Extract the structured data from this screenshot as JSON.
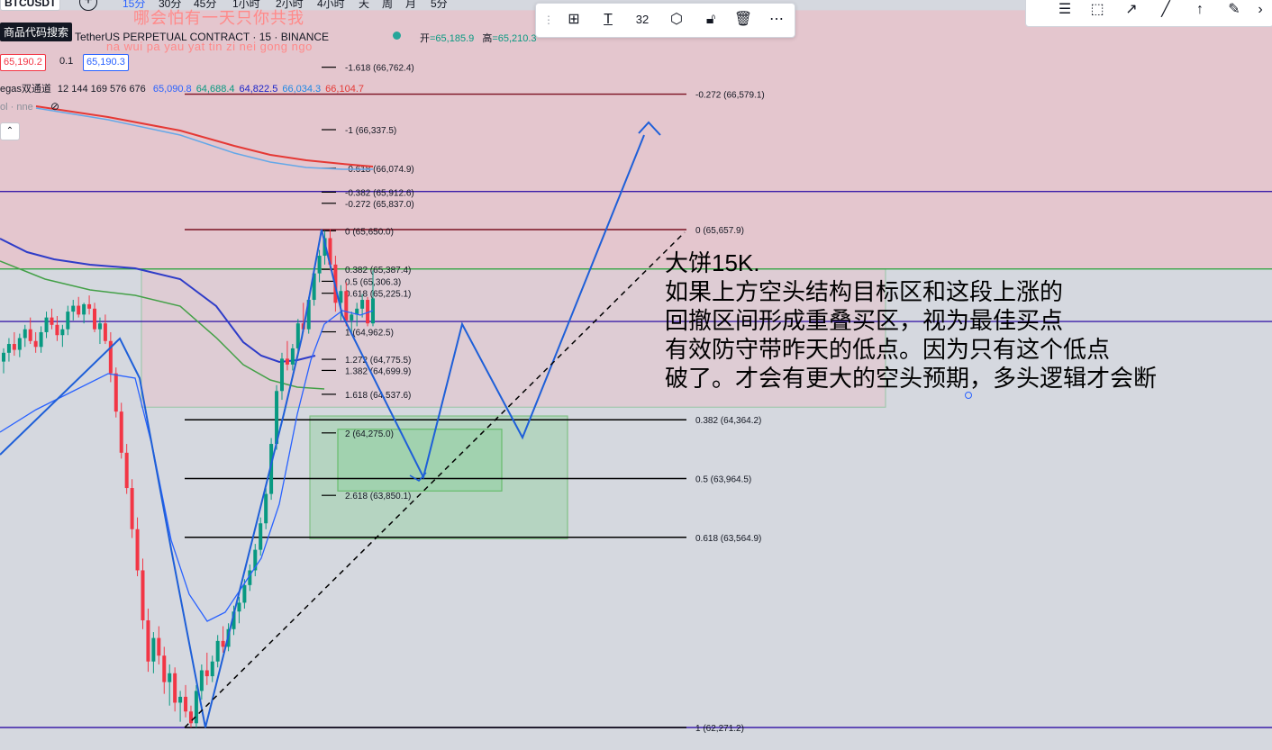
{
  "header": {
    "symbol": "BTCUSDT",
    "intervals": [
      "15分",
      "30分",
      "45分",
      "1小时",
      "2小时",
      "4小时",
      "天",
      "周",
      "月",
      "5分"
    ],
    "tooltip": "商品代码搜索",
    "watermark_line1": "哪会怕有一天只你共我",
    "watermark_line2": "na wui pa yau yat tin zi nei gong ngo",
    "title": "TetherUS PERPETUAL CONTRACT · 15 · BINANCE",
    "open_label": "开",
    "open_value": "=65,185.9",
    "high_label": "高",
    "high_value": "=65,210.3"
  },
  "prices": {
    "sell": "65,190.2",
    "step": "0.1",
    "buy": "65,190.3"
  },
  "indicator": {
    "name": "egas双通道",
    "params": "12 144 169 576 676",
    "values": [
      {
        "v": "65,090.8",
        "color": "#2962ff"
      },
      {
        "v": "64,688.4",
        "color": "#089981"
      },
      {
        "v": "64,822.5",
        "color": "#1a23c9"
      },
      {
        "v": "66,034.3",
        "color": "#1e88e5"
      },
      {
        "v": "66,104.7",
        "color": "#e53935"
      }
    ],
    "vol": "ol · nne"
  },
  "toolbar": {
    "line_width": "32"
  },
  "annotation": {
    "lines": [
      "大饼15K.",
      "如果上方空头结构目标区和这段上涨的",
      "回撤区间形成重叠买区，视为最佳买点",
      "有效防守带昨天的低点。因为只有这个低点",
      "破了。才会有更大的空头预期，多头逻辑才会断"
    ]
  },
  "chart_data": {
    "type": "candlestick",
    "symbol": "BTCUSDT",
    "timeframe": "15",
    "y_range": [
      62100,
      67200
    ],
    "fib_major": [
      {
        "level": "-0.272",
        "price": 66579.1
      },
      {
        "level": "0",
        "price": 65657.9
      },
      {
        "level": "0.382",
        "price": 64364.2
      },
      {
        "level": "0.5",
        "price": 63964.5
      },
      {
        "level": "0.618",
        "price": 63564.9
      },
      {
        "level": "1",
        "price": 62271.2
      }
    ],
    "fib_minor": [
      {
        "level": "-1.618",
        "price": 66762.4
      },
      {
        "level": "-1",
        "price": 66337.5
      },
      {
        "level": "-0.618",
        "price": 66074.9
      },
      {
        "level": "-0.382",
        "price": 65912.6
      },
      {
        "level": "-0.272",
        "price": 65837.0
      },
      {
        "level": "0",
        "price": 65650.0
      },
      {
        "level": "0.382",
        "price": 65387.4
      },
      {
        "level": "0.5",
        "price": 65306.3
      },
      {
        "level": "0.618",
        "price": 65225.1
      },
      {
        "level": "1",
        "price": 64962.5
      },
      {
        "level": "1.272",
        "price": 64775.5
      },
      {
        "level": "1.382",
        "price": 64699.9
      },
      {
        "level": "1.618",
        "price": 64537.6
      },
      {
        "level": "2",
        "price": 64275.0
      },
      {
        "level": "2.618",
        "price": 63850.1
      }
    ],
    "horizontal_levels": [
      65917,
      65390,
      65033,
      62271.2
    ],
    "candles": [
      [
        64760,
        64850,
        64680,
        64820
      ],
      [
        64820,
        64920,
        64760,
        64880
      ],
      [
        64880,
        64960,
        64800,
        64840
      ],
      [
        64840,
        64950,
        64790,
        64920
      ],
      [
        64920,
        65010,
        64860,
        64980
      ],
      [
        64980,
        65060,
        64880,
        64900
      ],
      [
        64900,
        64960,
        64820,
        64860
      ],
      [
        64860,
        65000,
        64820,
        64960
      ],
      [
        64960,
        65100,
        64920,
        65060
      ],
      [
        65060,
        65120,
        64980,
        65010
      ],
      [
        65010,
        65070,
        64900,
        64940
      ],
      [
        64940,
        65010,
        64860,
        64980
      ],
      [
        64980,
        65140,
        64940,
        65100
      ],
      [
        65100,
        65180,
        65040,
        65140
      ],
      [
        65140,
        65200,
        65060,
        65080
      ],
      [
        65080,
        65160,
        65020,
        65150
      ],
      [
        65150,
        65210,
        65080,
        65120
      ],
      [
        65120,
        65160,
        64960,
        64980
      ],
      [
        64980,
        65060,
        64880,
        65020
      ],
      [
        65020,
        65080,
        64880,
        64900
      ],
      [
        64900,
        64960,
        64620,
        64680
      ],
      [
        64680,
        64720,
        64380,
        64420
      ],
      [
        64420,
        64480,
        64100,
        64140
      ],
      [
        64140,
        64200,
        63860,
        63900
      ],
      [
        63900,
        63960,
        63560,
        63620
      ],
      [
        63620,
        63700,
        63300,
        63340
      ],
      [
        63340,
        63420,
        62940,
        63000
      ],
      [
        63000,
        63080,
        62650,
        62720
      ],
      [
        62720,
        62920,
        62640,
        62880
      ],
      [
        62880,
        62960,
        62700,
        62760
      ],
      [
        62760,
        62820,
        62500,
        62580
      ],
      [
        62580,
        62700,
        62420,
        62640
      ],
      [
        62640,
        62680,
        62380,
        62440
      ],
      [
        62440,
        62520,
        62310,
        62480
      ],
      [
        62480,
        62560,
        62340,
        62380
      ],
      [
        62380,
        62420,
        62271,
        62300
      ],
      [
        62300,
        62560,
        62271,
        62520
      ],
      [
        62520,
        62700,
        62460,
        62660
      ],
      [
        62660,
        62780,
        62560,
        62620
      ],
      [
        62620,
        62760,
        62580,
        62720
      ],
      [
        62720,
        62900,
        62680,
        62860
      ],
      [
        62860,
        62960,
        62780,
        62820
      ],
      [
        62820,
        62980,
        62790,
        62940
      ],
      [
        62940,
        63100,
        62900,
        63060
      ],
      [
        63060,
        63160,
        62980,
        63120
      ],
      [
        63120,
        63280,
        63080,
        63240
      ],
      [
        63240,
        63380,
        63200,
        63340
      ],
      [
        63340,
        63520,
        63300,
        63480
      ],
      [
        63480,
        63700,
        63440,
        63660
      ],
      [
        63660,
        63900,
        63620,
        63860
      ],
      [
        63860,
        64240,
        63820,
        64200
      ],
      [
        64200,
        64600,
        64160,
        64560
      ],
      [
        64560,
        64820,
        64500,
        64780
      ],
      [
        64780,
        64900,
        64700,
        64740
      ],
      [
        64740,
        64880,
        64700,
        64850
      ],
      [
        64850,
        65050,
        64800,
        65020
      ],
      [
        65020,
        65160,
        64960,
        64980
      ],
      [
        64980,
        65200,
        64950,
        65180
      ],
      [
        65180,
        65400,
        65140,
        65360
      ],
      [
        65360,
        65520,
        65300,
        65480
      ],
      [
        65480,
        65650,
        65420,
        65600
      ],
      [
        65600,
        65660,
        65380,
        65420
      ],
      [
        65420,
        65480,
        65100,
        65160
      ],
      [
        65160,
        65280,
        65040,
        65240
      ],
      [
        65240,
        65300,
        65000,
        65040
      ],
      [
        65040,
        65100,
        64940,
        65080
      ],
      [
        65080,
        65160,
        65000,
        65120
      ],
      [
        65120,
        65220,
        65060,
        65180
      ],
      [
        65180,
        65200,
        65000,
        65020
      ],
      [
        65020,
        65380,
        65000,
        65190
      ]
    ]
  }
}
